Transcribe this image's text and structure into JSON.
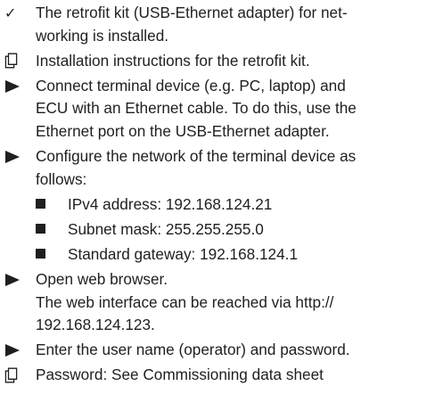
{
  "items": [
    {
      "type": "check",
      "lines": [
        "The retrofit kit (USB-Ethernet adapter) for net-",
        "working is installed."
      ]
    },
    {
      "type": "doc",
      "lines": [
        "Installation instructions for the retrofit kit."
      ]
    },
    {
      "type": "step",
      "lines": [
        "Connect terminal device (e.g. PC, laptop) and",
        "ECU with an Ethernet cable. To do this, use the",
        "Ethernet port on the USB-Ethernet adapter."
      ]
    },
    {
      "type": "step",
      "lines": [
        "Configure the network of the terminal device as",
        "follows:"
      ]
    },
    {
      "type": "step",
      "lines": [
        "Open web browser.",
        "The web interface can be reached via http://",
        "192.168.124.123."
      ]
    },
    {
      "type": "step",
      "lines": [
        "Enter the user name (operator) and password."
      ]
    },
    {
      "type": "doc",
      "lines": [
        "Password: See Commissioning data sheet"
      ]
    }
  ],
  "network_settings": [
    "IPv4 address: 192.168.124.21",
    "Subnet mask: 255.255.255.0",
    "Standard gateway: 192.168.124.1"
  ]
}
